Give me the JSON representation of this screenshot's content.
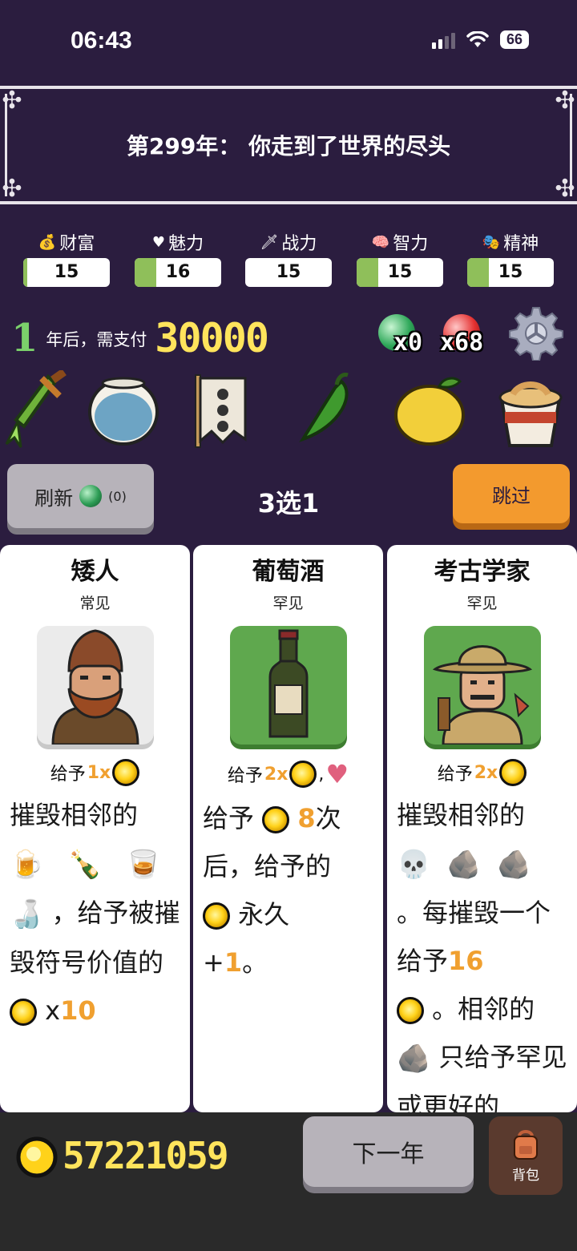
{
  "status_bar": {
    "time": "06:43",
    "battery": "66"
  },
  "banner": {
    "title": "第299年： 你走到了世界的尽头"
  },
  "stats": [
    {
      "label": "财富",
      "icon": "money-bag-icon",
      "value": "15",
      "fill": 0.05
    },
    {
      "label": "魅力",
      "icon": "heart-icon",
      "value": "16",
      "fill": 0.25
    },
    {
      "label": "战力",
      "icon": "sword-icon",
      "value": "15",
      "fill": 0.0
    },
    {
      "label": "智力",
      "icon": "brain-icon",
      "value": "15",
      "fill": 0.25
    },
    {
      "label": "精神",
      "icon": "mask-icon",
      "value": "15",
      "fill": 0.25
    }
  ],
  "payment": {
    "years": "1",
    "text": "年后，需支付",
    "amount": "30000"
  },
  "orbs": {
    "green": "x0",
    "red": "x68"
  },
  "inventory_items": [
    "poison-dagger-icon",
    "fishbowl-icon",
    "skull-banner-icon",
    "chili-pepper-icon",
    "lemon-icon",
    "instant-noodles-icon"
  ],
  "actions": {
    "refresh": "刷新",
    "refresh_count": "(0)",
    "choose": "3选1",
    "skip": "跳过"
  },
  "cards": [
    {
      "name": "矮人",
      "rarity": "常见",
      "portrait": "dwarf",
      "give_label": "给予",
      "give_mult": "1x",
      "desc": {
        "a": "摧毁相邻的",
        "b": "，给予被摧毁符号价值的",
        "mult_prefix": "x",
        "mult": "10"
      }
    },
    {
      "name": "葡萄酒",
      "rarity": "罕见",
      "portrait": "wine",
      "give_label": "给予",
      "give_mult": "2x",
      "give_sep": ",",
      "desc": {
        "a": "给予",
        "count": "8",
        "b": "次后，给予的",
        "c": "永久",
        "plus": "+",
        "inc": "1",
        "end": "。"
      }
    },
    {
      "name": "考古学家",
      "rarity": "罕见",
      "portrait": "archaeologist",
      "give_label": "给予",
      "give_mult": "2x",
      "desc": {
        "a": "摧毁相邻的",
        "b": "。每摧毁一个给予",
        "num": "16",
        "c": "。相邻的",
        "d": "只给予罕见或更好的"
      }
    }
  ],
  "footer": {
    "gold": "57221059",
    "next": "下一年",
    "bag": "背包"
  },
  "colors": {
    "background": "#2b1d3f",
    "gold": "#ffe45c",
    "accent_orange": "#f39a2e",
    "stat_fill": "#8fbf5a"
  }
}
